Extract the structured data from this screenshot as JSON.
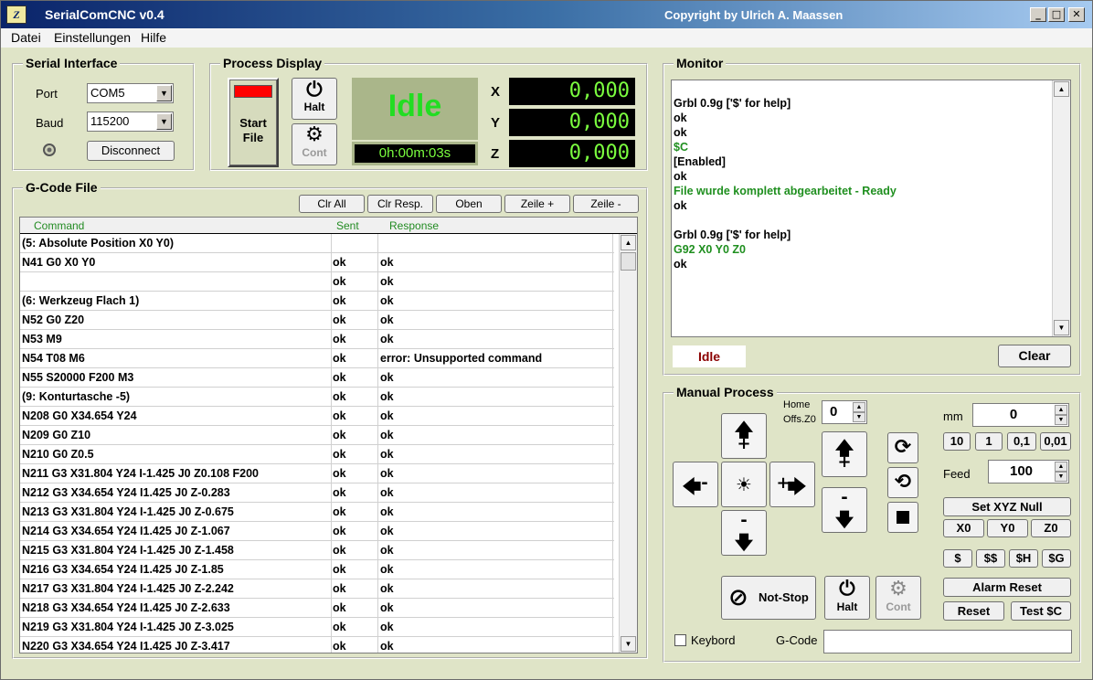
{
  "window": {
    "title": "SerialComCNC  v0.4",
    "copyright": "Copyright by Ulrich A. Maassen",
    "minimize": "_",
    "maximize": "□",
    "close": "✕",
    "icon_text": "Z"
  },
  "menu": {
    "items": [
      "Datei",
      "Einstellungen",
      "Hilfe"
    ]
  },
  "serial": {
    "group_title": "Serial Interface",
    "port_label": "Port",
    "port_value": "COM5",
    "baud_label": "Baud",
    "baud_value": "115200",
    "disconnect_label": "Disconnect"
  },
  "process": {
    "group_title": "Process Display",
    "start_label_1": "Start",
    "start_label_2": "File",
    "halt_label": "Halt",
    "cont_label": "Cont",
    "status": "Idle",
    "elapsed": "0h:00m:03s",
    "x_label": "X",
    "x_value": "0,000",
    "y_label": "Y",
    "y_value": "0,000",
    "z_label": "Z",
    "z_value": "0,000"
  },
  "gcode": {
    "group_title": "G-Code File",
    "buttons": [
      "Clr All",
      "Clr Resp.",
      "Oben",
      "Zeile +",
      "Zeile -"
    ],
    "columns": [
      "Command",
      "Sent",
      "Response"
    ],
    "rows": [
      [
        "(5: Absolute Position X0 Y0)",
        "",
        ""
      ],
      [
        "N41 G0 X0 Y0",
        "ok",
        "ok"
      ],
      [
        "",
        "ok",
        "ok"
      ],
      [
        "(6: Werkzeug Flach 1)",
        "ok",
        "ok"
      ],
      [
        "N52 G0 Z20",
        "ok",
        "ok"
      ],
      [
        "N53 M9",
        "ok",
        "ok"
      ],
      [
        "N54 T08 M6",
        "ok",
        "error: Unsupported command"
      ],
      [
        "N55 S20000 F200 M3",
        "ok",
        "ok"
      ],
      [
        "(9: Konturtasche -5)",
        "ok",
        "ok"
      ],
      [
        "N208 G0 X34.654 Y24",
        "ok",
        "ok"
      ],
      [
        "N209 G0 Z10",
        "ok",
        "ok"
      ],
      [
        "N210 G0 Z0.5",
        "ok",
        "ok"
      ],
      [
        "N211 G3 X31.804 Y24 I-1.425 J0 Z0.108 F200",
        "ok",
        "ok"
      ],
      [
        "N212 G3 X34.654 Y24 I1.425 J0 Z-0.283",
        "ok",
        "ok"
      ],
      [
        "N213 G3 X31.804 Y24 I-1.425 J0 Z-0.675",
        "ok",
        "ok"
      ],
      [
        "N214 G3 X34.654 Y24 I1.425 J0 Z-1.067",
        "ok",
        "ok"
      ],
      [
        "N215 G3 X31.804 Y24 I-1.425 J0 Z-1.458",
        "ok",
        "ok"
      ],
      [
        "N216 G3 X34.654 Y24 I1.425 J0 Z-1.85",
        "ok",
        "ok"
      ],
      [
        "N217 G3 X31.804 Y24 I-1.425 J0 Z-2.242",
        "ok",
        "ok"
      ],
      [
        "N218 G3 X34.654 Y24 I1.425 J0 Z-2.633",
        "ok",
        "ok"
      ],
      [
        "N219 G3 X31.804 Y24 I-1.425 J0 Z-3.025",
        "ok",
        "ok"
      ],
      [
        "N220 G3 X34.654 Y24 I1.425 J0 Z-3.417",
        "ok",
        "ok"
      ]
    ]
  },
  "monitor": {
    "group_title": "Monitor",
    "lines": [
      {
        "text": "Grbl 0.9g ['$' for help]",
        "color": "#000000"
      },
      {
        "text": "ok",
        "color": "#000000"
      },
      {
        "text": "ok",
        "color": "#000000"
      },
      {
        "text": "$C",
        "color": "#1f8f1f"
      },
      {
        "text": "[Enabled]",
        "color": "#000000"
      },
      {
        "text": "ok",
        "color": "#000000"
      },
      {
        "text": "File wurde komplett abgearbeitet - Ready",
        "color": "#1f8f1f"
      },
      {
        "text": "ok",
        "color": "#000000"
      },
      {
        "text": "",
        "color": "#000000"
      },
      {
        "text": "Grbl 0.9g ['$' for help]",
        "color": "#000000"
      },
      {
        "text": "G92 X0 Y0 Z0",
        "color": "#1f8f1f"
      },
      {
        "text": "ok",
        "color": "#000000"
      }
    ],
    "status": "Idle",
    "clear_label": "Clear"
  },
  "manual": {
    "group_title": "Manual Process",
    "home_label_1": "Home",
    "home_label_2": "Offs.Z0",
    "home_value": "0",
    "mm_label": "mm",
    "mm_value": "0",
    "step_buttons": [
      "10",
      "1",
      "0,1",
      "0,01"
    ],
    "feed_label": "Feed",
    "feed_value": "100",
    "set_null_label": "Set XYZ Null",
    "axis_null_buttons": [
      "X0",
      "Y0",
      "Z0"
    ],
    "grbl_buttons": [
      "$",
      "$$",
      "$H",
      "$G"
    ],
    "alarm_reset_label": "Alarm Reset",
    "reset_label": "Reset",
    "test_label": "Test $C",
    "notstop_label": "Not-Stop",
    "halt_label": "Halt",
    "cont_label": "Cont",
    "keyboard_label": "Keybord",
    "gcode_label": "G-Code",
    "gcode_value": "",
    "jog_plus": "+",
    "jog_minus": "-"
  }
}
